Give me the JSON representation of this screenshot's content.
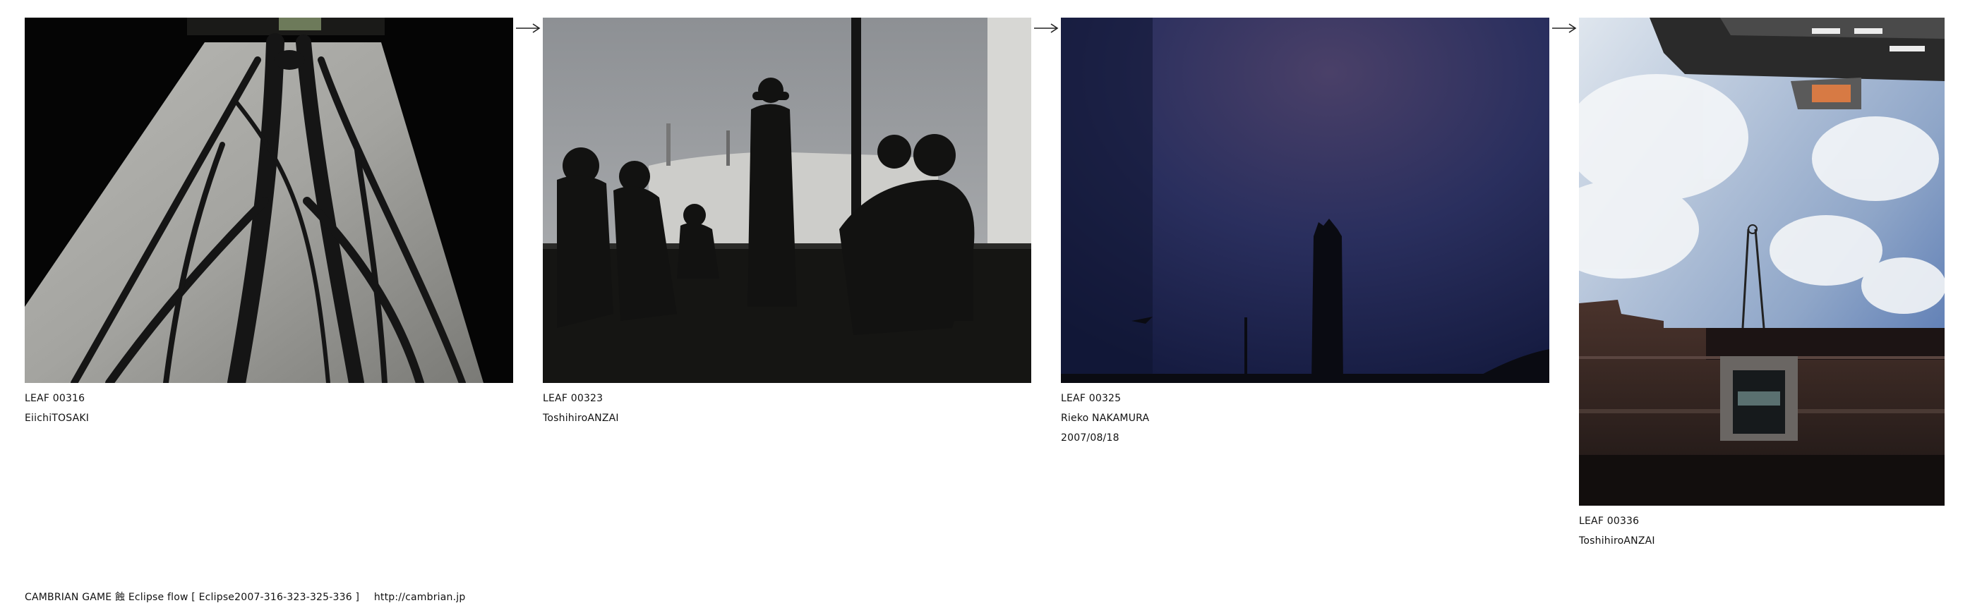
{
  "leaves": [
    {
      "id": "LEAF 00316",
      "author": "EiichiTOSAKI",
      "date": ""
    },
    {
      "id": "LEAF 00323",
      "author": "ToshihiroANZAI",
      "date": ""
    },
    {
      "id": "LEAF 00325",
      "author": "Rieko NAKAMURA",
      "date": "2007/08/18"
    },
    {
      "id": "LEAF 00336",
      "author": "ToshihiroANZAI",
      "date": ""
    }
  ],
  "flow_arrow": "→",
  "footer": {
    "title": "CAMBRIAN GAME  蝕 Eclipse  flow [ Eclipse2007-316-323-325-336 ]",
    "url": "http://cambrian.jp"
  }
}
